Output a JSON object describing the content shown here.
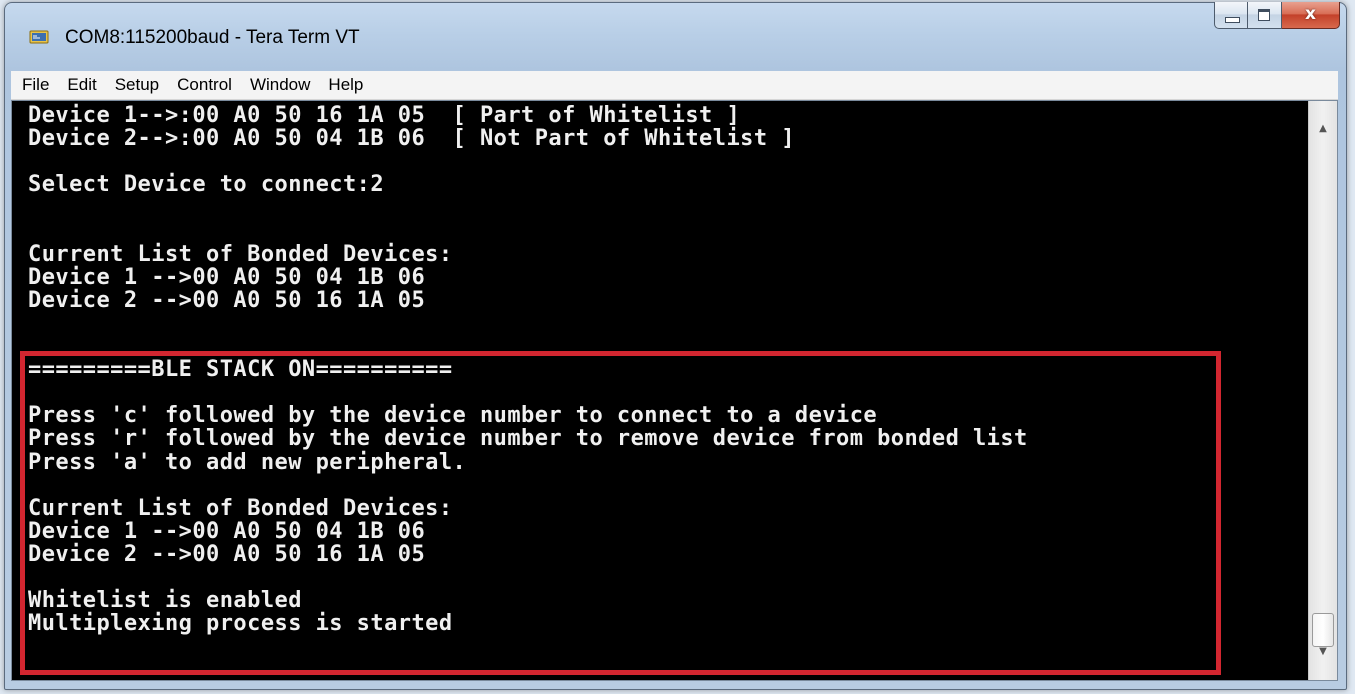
{
  "window": {
    "title": "COM8:115200baud - Tera Term VT",
    "app_icon": "tera-term-icon",
    "caption_buttons": {
      "minimize": "minimize-icon",
      "maximize": "maximize-icon",
      "close": "close-icon",
      "close_glyph": "x"
    }
  },
  "menubar": {
    "items": [
      "File",
      "Edit",
      "Setup",
      "Control",
      "Window",
      "Help"
    ]
  },
  "terminal": {
    "lines": [
      "Device 1-->:00 A0 50 16 1A 05  [ Part of Whitelist ]",
      "Device 2-->:00 A0 50 04 1B 06  [ Not Part of Whitelist ]",
      "",
      "Select Device to connect:2",
      "",
      "",
      "Current List of Bonded Devices:",
      "Device 1 -->00 A0 50 04 1B 06",
      "Device 2 -->00 A0 50 16 1A 05",
      "",
      "",
      "=========BLE STACK ON==========",
      "",
      "Press 'c' followed by the device number to connect to a device",
      "Press 'r' followed by the device number to remove device from bonded list",
      "Press 'a' to add new peripheral.",
      "",
      "Current List of Bonded Devices:",
      "Device 1 -->00 A0 50 04 1B 06",
      "Device 2 -->00 A0 50 16 1A 05",
      "",
      "Whitelist is enabled",
      "Multiplexing process is started"
    ],
    "text_color": "#f0f0f0",
    "background_color": "#000000",
    "highlight_color": "#d22630"
  },
  "scrollbar": {
    "up_icon": "scroll-up-arrow-icon",
    "down_icon": "scroll-down-arrow-icon"
  }
}
